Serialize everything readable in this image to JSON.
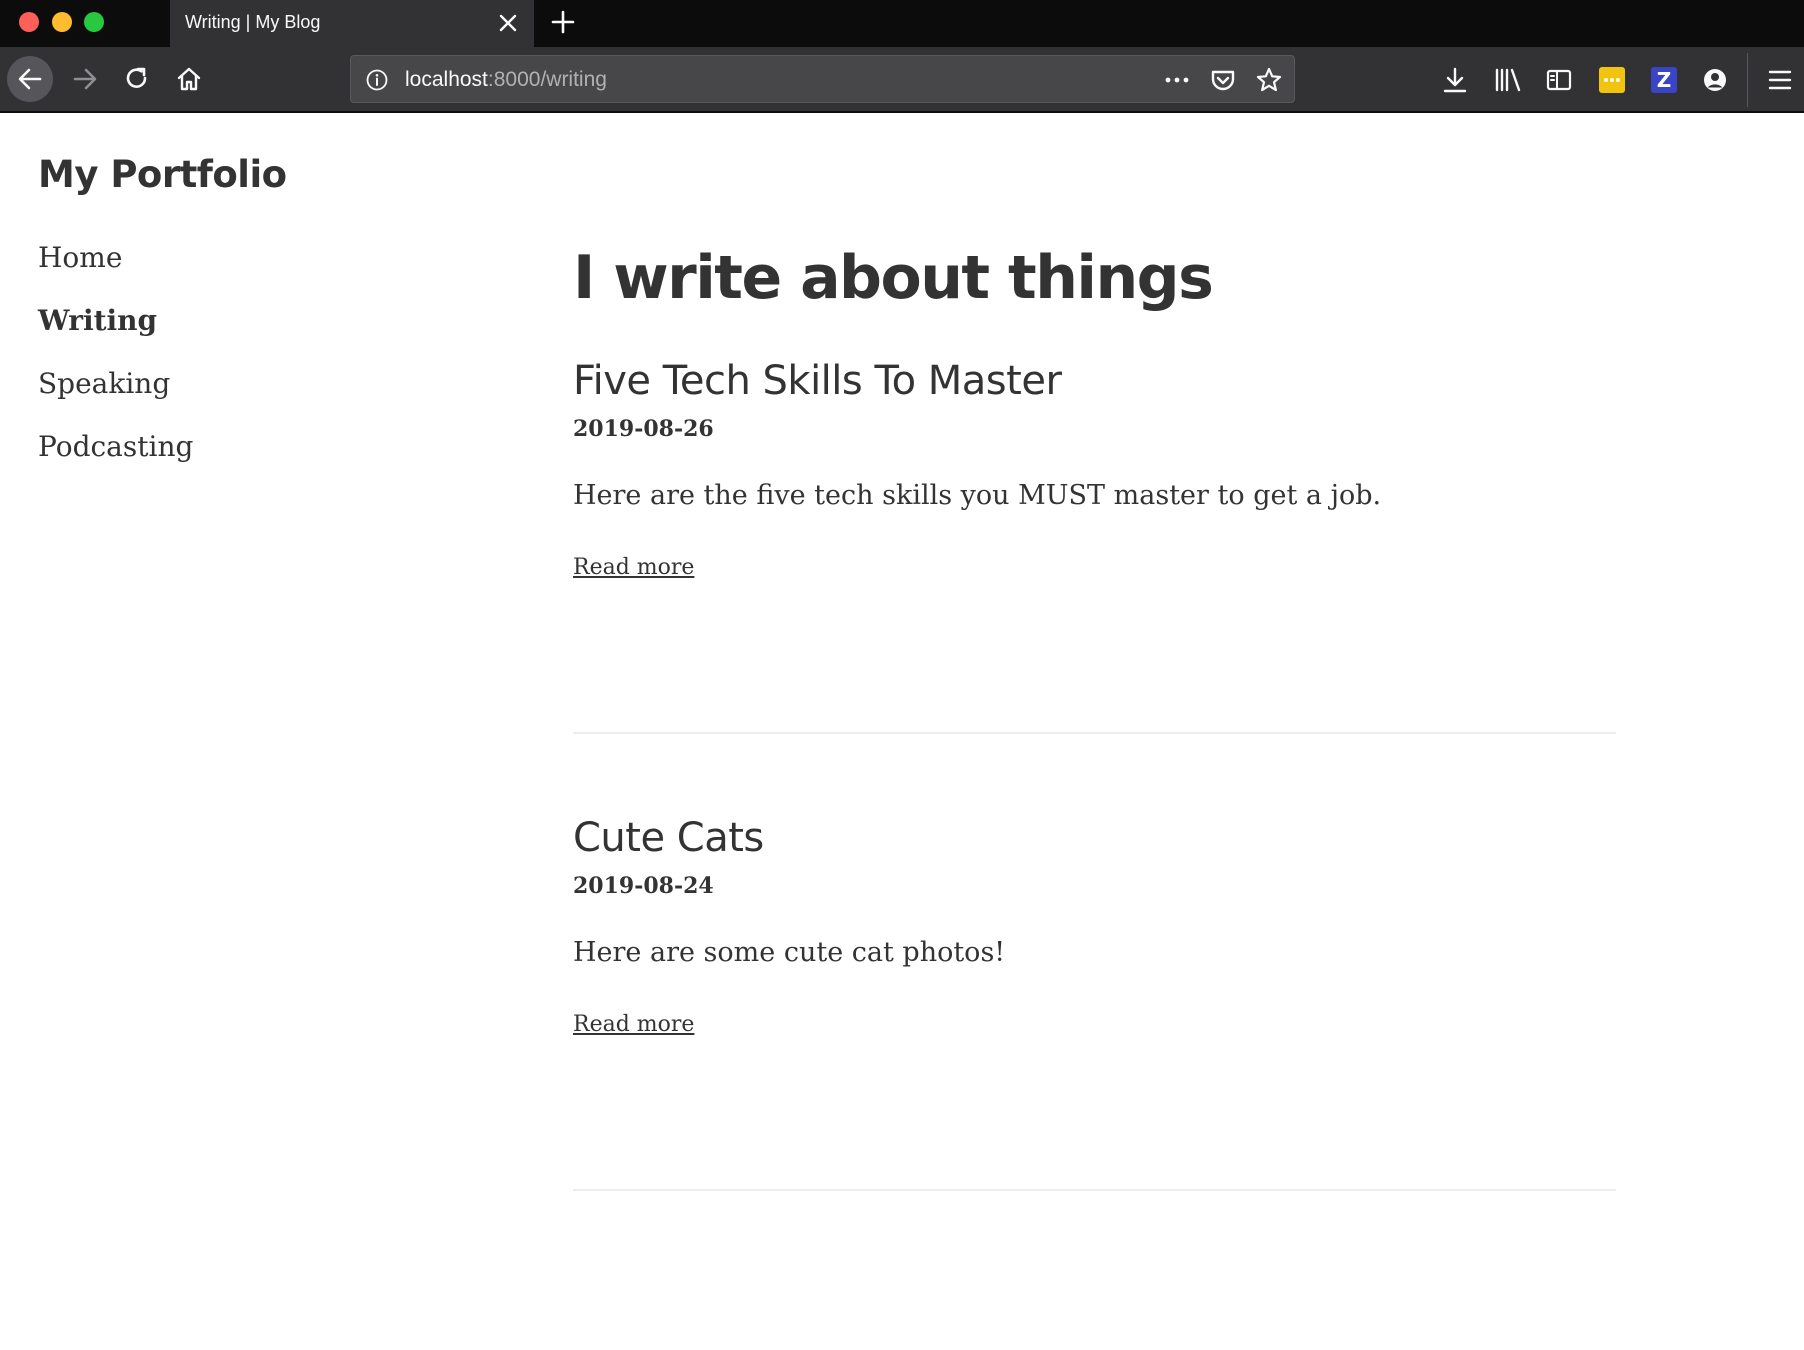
{
  "browser": {
    "tab_title": "Writing | My Blog",
    "url_host": "localhost",
    "url_path": ":8000/writing"
  },
  "site": {
    "title": "My Portfolio",
    "nav": [
      {
        "label": "Home",
        "active": false
      },
      {
        "label": "Writing",
        "active": true
      },
      {
        "label": "Speaking",
        "active": false
      },
      {
        "label": "Podcasting",
        "active": false
      }
    ]
  },
  "main": {
    "heading": "I write about things",
    "posts": [
      {
        "title": "Five Tech Skills To Master",
        "date": "2019-08-26",
        "summary": "Here are the five tech skills you MUST master to get a job.",
        "link_label": "Read more"
      },
      {
        "title": "Cute Cats",
        "date": "2019-08-24",
        "summary": "Here are some cute cat photos!",
        "link_label": "Read more"
      }
    ]
  },
  "colors": {
    "text": "#333333",
    "chrome_dark": "#0c0c0d",
    "chrome_toolbar": "#323234",
    "ext_yellow": "#f2c40f",
    "ext_blue": "#3a44c6"
  },
  "icons": {
    "nav": [
      "back-arrow-icon",
      "forward-arrow-icon",
      "reload-icon",
      "home-icon"
    ],
    "url": [
      "info-icon",
      "more-actions-icon",
      "pocket-icon",
      "bookmark-star-icon"
    ],
    "toolbar": [
      "download-icon",
      "library-icon",
      "sidebar-icon",
      "extension-icon",
      "zotero-icon",
      "account-icon",
      "hamburger-menu-icon"
    ]
  }
}
